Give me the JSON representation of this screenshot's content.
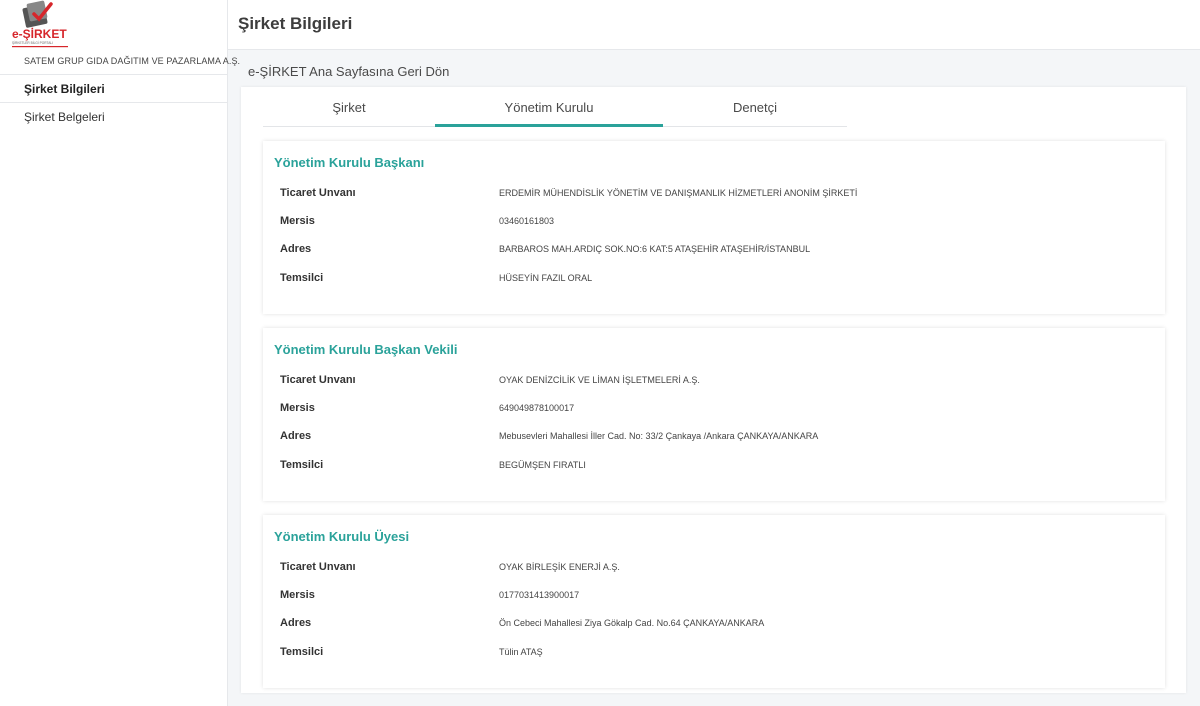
{
  "logo": {
    "text": "e-ŞİRKET",
    "subtext": "ŞİRKETLER BİLGİ PORTALI"
  },
  "sidebar": {
    "company_name": "SATEM GRUP GIDA DAĞITIM VE PAZARLAMA A.Ş.",
    "items": [
      {
        "label": "Şirket Bilgileri",
        "active": true
      },
      {
        "label": "Şirket Belgeleri",
        "active": false
      }
    ]
  },
  "header": {
    "title": "Şirket Bilgileri"
  },
  "back_link": "e-ŞİRKET Ana Sayfasına Geri Dön",
  "tabs": [
    {
      "label": "Şirket",
      "active": false
    },
    {
      "label": "Yönetim Kurulu",
      "active": true
    },
    {
      "label": "Denetçi",
      "active": false
    }
  ],
  "colors": {
    "accent": "#2aa29a",
    "logo_red": "#d6262b"
  },
  "sections": [
    {
      "title": "Yönetim Kurulu Başkanı",
      "rows": [
        {
          "label": "Ticaret Unvanı",
          "value": "ERDEMİR MÜHENDİSLİK YÖNETİM VE DANIŞMANLIK HİZMETLERİ ANONİM ŞİRKETİ"
        },
        {
          "label": "Mersis",
          "value": "03460161803"
        },
        {
          "label": "Adres",
          "value": "BARBAROS MAH.ARDIÇ SOK.NO:6 KAT:5 ATAŞEHİR ATAŞEHİR/İSTANBUL"
        },
        {
          "label": "Temsilci",
          "value": "HÜSEYİN FAZIL ORAL"
        }
      ]
    },
    {
      "title": "Yönetim Kurulu Başkan Vekili",
      "rows": [
        {
          "label": "Ticaret Unvanı",
          "value": "OYAK DENİZCİLİK VE LİMAN İŞLETMELERİ A.Ş."
        },
        {
          "label": "Mersis",
          "value": "649049878100017"
        },
        {
          "label": "Adres",
          "value": "Mebusevleri Mahallesi İller Cad. No: 33/2 Çankaya /Ankara ÇANKAYA/ANKARA"
        },
        {
          "label": "Temsilci",
          "value": "BEGÜMŞEN FIRATLI"
        }
      ]
    },
    {
      "title": "Yönetim Kurulu Üyesi",
      "rows": [
        {
          "label": "Ticaret Unvanı",
          "value": "OYAK BİRLEŞİK ENERJİ A.Ş."
        },
        {
          "label": "Mersis",
          "value": "0177031413900017"
        },
        {
          "label": "Adres",
          "value": "Ön Cebeci Mahallesi Ziya Gökalp Cad. No.64 ÇANKAYA/ANKARA"
        },
        {
          "label": "Temsilci",
          "value": "Tülin ATAŞ"
        }
      ]
    }
  ]
}
